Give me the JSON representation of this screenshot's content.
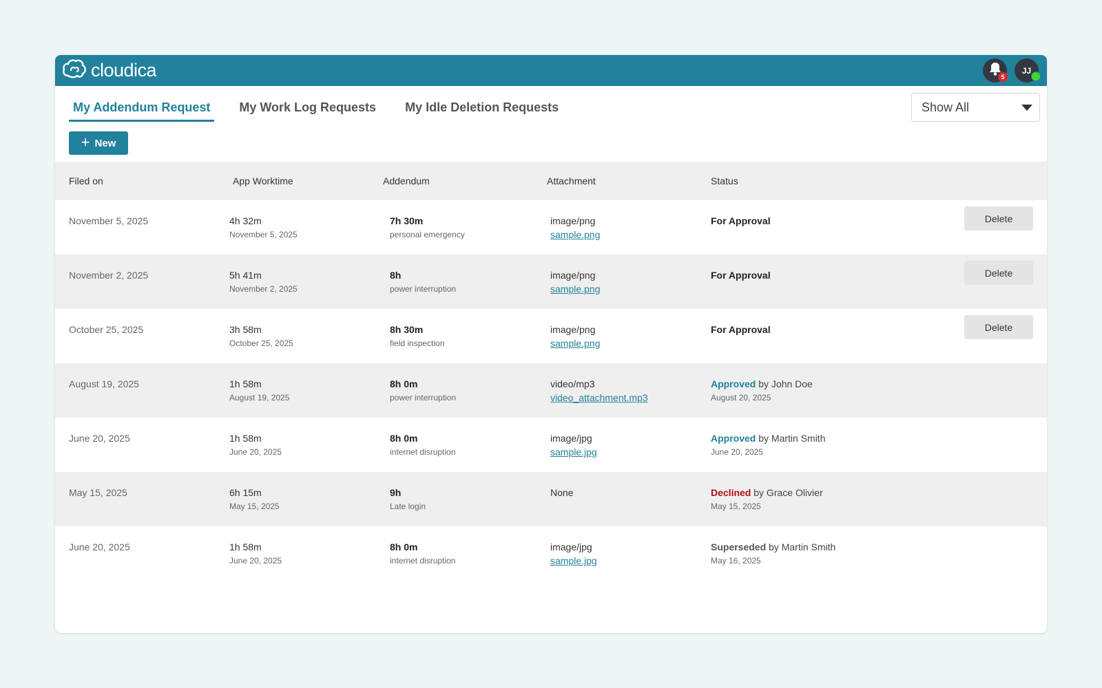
{
  "app": {
    "brand_name": "cloudica"
  },
  "header": {
    "notification_count": "5",
    "user_initials": "JJ"
  },
  "tabs": [
    {
      "label": "My Addendum Request",
      "active": true
    },
    {
      "label": "My Work Log Requests",
      "active": false
    },
    {
      "label": "My Idle Deletion Requests",
      "active": false
    }
  ],
  "filter": {
    "selected": "Show All"
  },
  "actions": {
    "new_label": "New"
  },
  "table": {
    "columns": [
      "Filed on",
      "App Worktime",
      "Addendum",
      "Attachment",
      "Status"
    ],
    "delete_label": "Delete",
    "rows": [
      {
        "filed_on": "November 5, 2025",
        "worktime": "4h 32m",
        "worktime_date": "November 5, 2025",
        "addendum": "7h 30m",
        "reason": "personal emergency",
        "attach_type": "image/png",
        "attach_file": "sample.png",
        "status": "For Approval",
        "status_by": "",
        "status_date": ""
      },
      {
        "filed_on": "November 2, 2025",
        "worktime": "5h 41m",
        "worktime_date": "November 2, 2025",
        "addendum": "8h",
        "reason": "power interruption",
        "attach_type": "image/png",
        "attach_file": "sample.png",
        "status": "For Approval",
        "status_by": "",
        "status_date": ""
      },
      {
        "filed_on": "October 25, 2025",
        "worktime": "3h 58m",
        "worktime_date": "October 25, 2025",
        "addendum": "8h 30m",
        "reason": "field inspection",
        "attach_type": "image/png",
        "attach_file": "sample.png",
        "status": "For Approval",
        "status_by": "",
        "status_date": ""
      },
      {
        "filed_on": "August 19, 2025",
        "worktime": "1h 58m",
        "worktime_date": "August 19, 2025",
        "addendum": "8h 0m",
        "reason": "power interruption",
        "attach_type": "video/mp3",
        "attach_file": "video_attachment.mp3",
        "status": "Approved",
        "status_by": " by John Doe",
        "status_date": "August 20, 2025"
      },
      {
        "filed_on": "June 20, 2025",
        "worktime": "1h 58m",
        "worktime_date": "June 20, 2025",
        "addendum": "8h 0m",
        "reason": "internet disruption",
        "attach_type": "image/jpg",
        "attach_file": "sample.jpg",
        "status": "Approved",
        "status_by": " by Martin Smith",
        "status_date": "June 20, 2025"
      },
      {
        "filed_on": "May 15, 2025",
        "worktime": "6h 15m",
        "worktime_date": "May 15, 2025",
        "addendum": "9h",
        "reason": "Late login",
        "attach_type": "None",
        "attach_file": "",
        "status": "Declined",
        "status_by": " by Grace Olivier",
        "status_date": "May 15, 2025"
      },
      {
        "filed_on": "June 20, 2025",
        "worktime": "1h 58m",
        "worktime_date": "June 20, 2025",
        "addendum": "8h 0m",
        "reason": "internet disruption",
        "attach_type": "image/jpg",
        "attach_file": "sample.jpg",
        "status": "Superseded",
        "status_by": " by Martin Smith",
        "status_date": "May 16, 2025"
      }
    ]
  },
  "colors": {
    "brand": "#22819c",
    "approved": "#22819c",
    "declined": "#b01018",
    "badge": "#e0262e",
    "online": "#3fd82c"
  },
  "icons": {
    "logo": "cloud-icon",
    "notifications": "bell-icon",
    "filter": "caret-down-icon",
    "new": "plus-icon"
  }
}
